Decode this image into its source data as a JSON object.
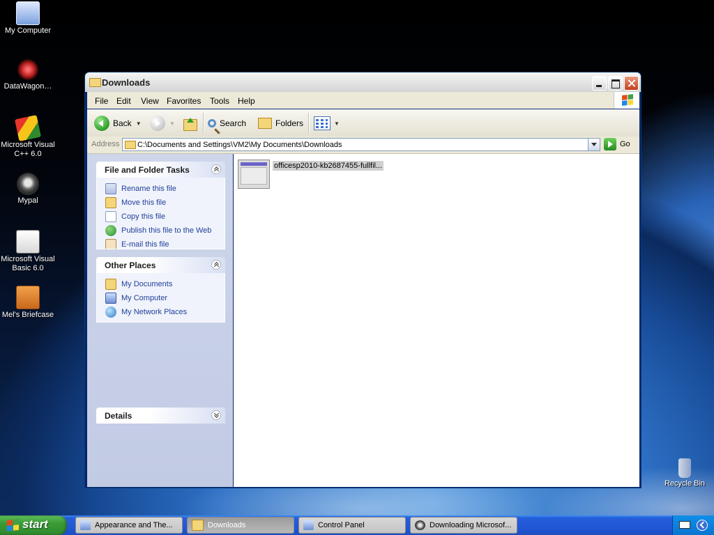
{
  "colors": {
    "desktop_space": "#000000",
    "taskbar_blue": "#245edb",
    "start_green": "#3a9a36",
    "sidebar_link": "#21409a",
    "selection_gray": "#d0d0d0"
  },
  "desktop": {
    "icons": [
      {
        "label": "My Computer",
        "icon": "my-computer-icon"
      },
      {
        "label": "DataWagon…",
        "icon": "datawagon-icon"
      },
      {
        "label": "Microsoft Visual C++ 6.0",
        "icon": "visual-cpp-icon"
      },
      {
        "label": "Mypal",
        "icon": "mypal-icon"
      },
      {
        "label": "Microsoft Visual Basic 6.0",
        "icon": "visual-basic-icon"
      },
      {
        "label": "Mel's Briefcase",
        "icon": "briefcase-icon"
      },
      {
        "label": "Recycle Bin",
        "icon": "recycle-bin-icon"
      }
    ]
  },
  "window": {
    "title": "Downloads",
    "menu": [
      "File",
      "Edit",
      "View",
      "Favorites",
      "Tools",
      "Help"
    ],
    "toolbar": {
      "back": "Back",
      "search": "Search",
      "folders": "Folders"
    },
    "address": {
      "label": "Address",
      "value": "C:\\Documents and Settings\\VM2\\My Documents\\Downloads",
      "go": "Go"
    },
    "sidebar": {
      "file_tasks": {
        "title": "File and Folder Tasks",
        "items": [
          "Rename this file",
          "Move this file",
          "Copy this file",
          "Publish this file to the Web",
          "E-mail this file"
        ]
      },
      "other_places": {
        "title": "Other Places",
        "items": [
          "My Documents",
          "My Computer",
          "My Network Places"
        ]
      },
      "details": {
        "title": "Details"
      }
    },
    "files": [
      {
        "name": "officesp2010-kb2687455-fullfil...",
        "selected": true
      }
    ]
  },
  "taskbar": {
    "start": "start",
    "tasks": [
      {
        "label": "Appearance and The...",
        "active": false
      },
      {
        "label": "Downloads",
        "active": true
      },
      {
        "label": "Control Panel",
        "active": false
      },
      {
        "label": "Downloading Microsof...",
        "active": false
      }
    ]
  }
}
